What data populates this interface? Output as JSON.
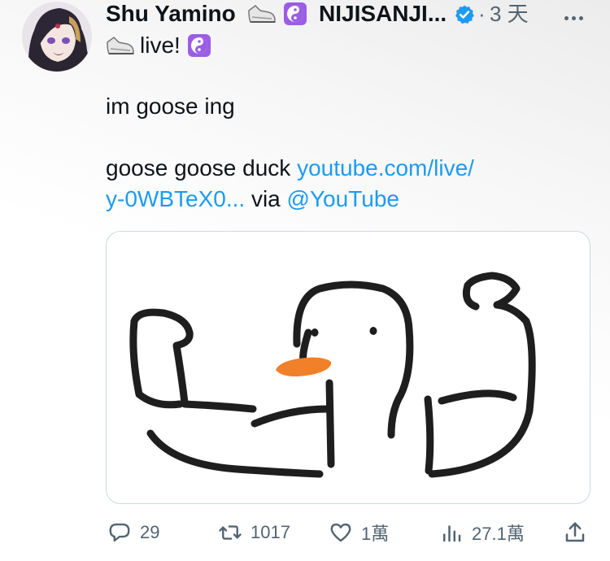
{
  "tweet": {
    "author_name": "Shu Yamino",
    "org_name": "NIJISANJI...",
    "separator": "·",
    "timestamp": "3 天",
    "name_suffix": "live!",
    "body_line1": "im goose ing",
    "body_line2_text": "goose goose duck ",
    "body_link1": "youtube.com/live/",
    "body_link2": "y-0WBTeX0...",
    "body_via": " via ",
    "body_mention": "@YouTube"
  },
  "actions": {
    "replies": "29",
    "retweets": "1017",
    "likes": "1萬",
    "views": "27.1萬"
  },
  "icons": {
    "reply": "reply-icon",
    "retweet": "retweet-icon",
    "like": "heart-icon",
    "views": "views-icon",
    "share": "share-icon",
    "more": "more-icon",
    "verified": "verified-badge-icon"
  },
  "colors": {
    "link": "#1d9bf0",
    "muted": "#536471",
    "text": "#0f1419",
    "verified": "#1d9bf0",
    "yinyang_bg": "#9b5de5",
    "beak": "#f0802a"
  }
}
